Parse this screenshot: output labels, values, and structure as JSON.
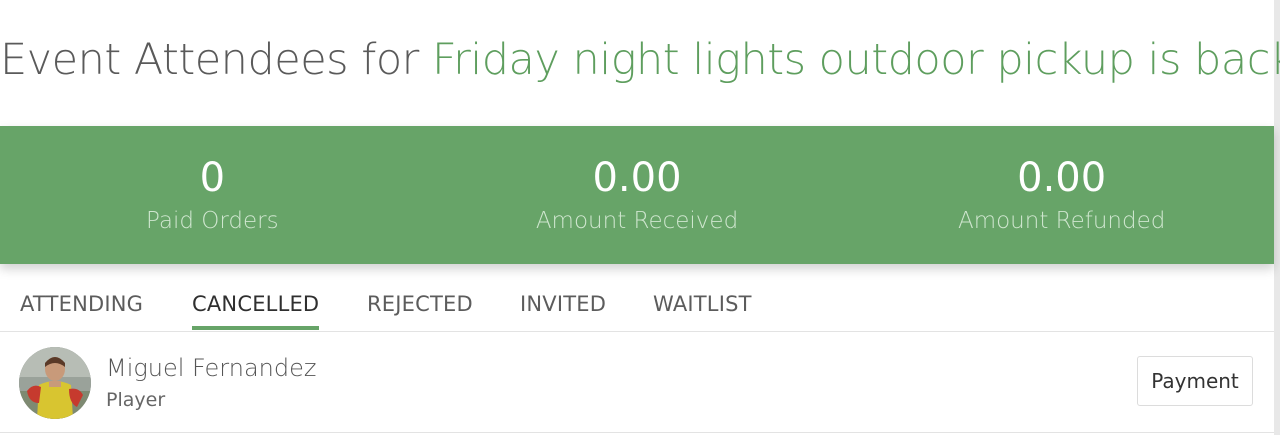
{
  "header": {
    "title_prefix": "Event Attendees for",
    "event_name": "Friday night lights outdoor pickup is back!"
  },
  "stats": [
    {
      "value": "0",
      "label": "Paid Orders"
    },
    {
      "value": "0.00",
      "label": "Amount Received"
    },
    {
      "value": "0.00",
      "label": "Amount Refunded"
    }
  ],
  "tabs": [
    {
      "label": "ATTENDING",
      "active": false
    },
    {
      "label": "CANCELLED",
      "active": true
    },
    {
      "label": "REJECTED",
      "active": false
    },
    {
      "label": "INVITED",
      "active": false
    },
    {
      "label": "WAITLIST",
      "active": false
    }
  ],
  "attendees": [
    {
      "name": "Miguel Fernandez",
      "role": "Player",
      "action_label": "Payment"
    }
  ],
  "colors": {
    "accent_green": "#67a468",
    "event_name_green": "#5e9e5e",
    "stat_label": "#cfe6cf"
  }
}
